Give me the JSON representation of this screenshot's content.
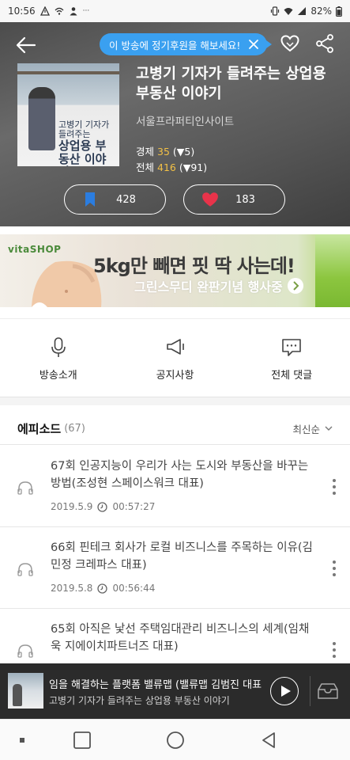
{
  "status_bar": {
    "time": "10:56",
    "dots": "···",
    "battery": "82%"
  },
  "header": {
    "tooltip": "이 방송에 정기후원을 해보세요!"
  },
  "podcast": {
    "title": "고병기 기자가 들려주는 상업용 부동산 이야기",
    "publisher": "서울프라퍼티인사이트",
    "rank_economy_label": "경제",
    "rank_economy_num": "35",
    "rank_economy_change": "(▼5)",
    "rank_total_label": "전체",
    "rank_total_num": "416",
    "rank_total_change": "(▼91)",
    "cover_text_1": "고병기 기자가 들려주는",
    "cover_text_2": "상업용 부동산 이야기"
  },
  "actions": {
    "bookmark_count": "428",
    "like_count": "183"
  },
  "ad": {
    "brand": "vitaSHOP",
    "headline": "5kg만 빼면 핏 딱 사는데!",
    "sub": "그린스무디 완판기념 행사중"
  },
  "menu": [
    {
      "label": "방송소개",
      "icon": "mic-icon"
    },
    {
      "label": "공지사항",
      "icon": "megaphone-icon"
    },
    {
      "label": "전체 댓글",
      "icon": "comment-icon"
    }
  ],
  "episodes_section": {
    "title": "에피소드",
    "count": "(67)",
    "sort": "최신순"
  },
  "episodes": [
    {
      "title": "67회 인공지능이 우리가 사는 도시와 부동산을 바꾸는 방법(조성현 스페이스워크 대표)",
      "date": "2019.5.9",
      "duration": "00:57:27"
    },
    {
      "title": "66회 핀테크 회사가 로컬 비즈니스를 주목하는 이유(김민정 크레파스 대표)",
      "date": "2019.5.8",
      "duration": "00:56:44"
    },
    {
      "title": "65회 아직은 낯선 주택임대관리 비즈니스의 세계(임채욱 지에이치파트너즈 대표)",
      "date": "",
      "duration": ""
    }
  ],
  "player": {
    "now_playing": "임을 해결하는 플랫폼 밸류맵 (밸류맵 김범진 대표",
    "show_name": "고병기 기자가 들려주는 상업용 부동산 이야기"
  },
  "colors": {
    "accent_blue": "#3aa0f0",
    "bookmark_blue": "#2b7de0",
    "heart_red": "#e8334a",
    "rank_yellow": "#f2c046"
  }
}
